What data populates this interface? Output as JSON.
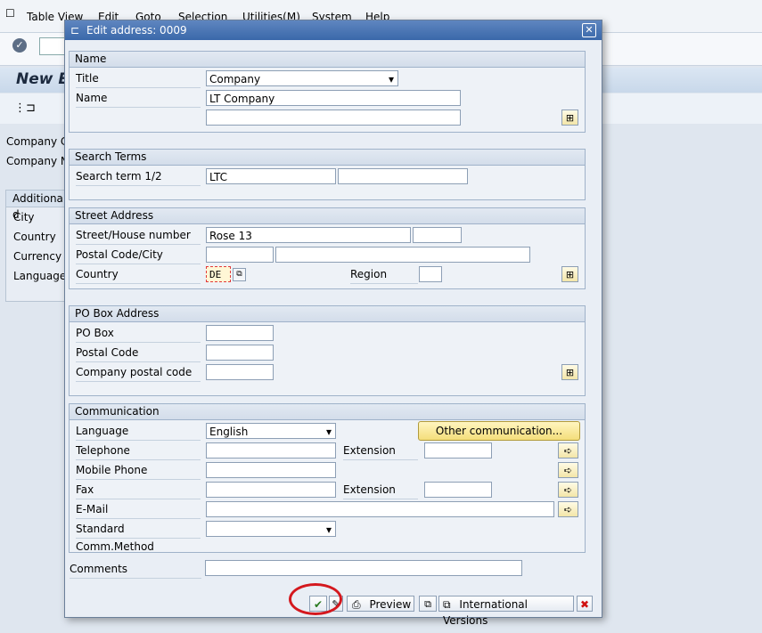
{
  "menu": {
    "items": [
      "Table View",
      "Edit",
      "Goto",
      "Selection",
      "Utilities(M)",
      "System",
      "Help"
    ]
  },
  "app": {
    "title": "New E",
    "fields": [
      "Company Co",
      "Company Na"
    ],
    "additional_header": "Additional d",
    "additional_rows": [
      "City",
      "Country",
      "Currency",
      "Language"
    ]
  },
  "dialog": {
    "title": "Edit address:  0009",
    "close_label": "✕",
    "name_group": {
      "header": "Name",
      "title_label": "Title",
      "title_value": "Company",
      "name_label": "Name",
      "name_value": "LT Company",
      "name2_value": ""
    },
    "search_group": {
      "header": "Search Terms",
      "label": "Search term 1/2",
      "term1": "LTC",
      "term2": ""
    },
    "street_group": {
      "header": "Street Address",
      "street_label": "Street/House number",
      "street_value": "Rose 13",
      "house_value": "",
      "postal_label": "Postal Code/City",
      "postal_value": "",
      "city_value": "",
      "country_label": "Country",
      "country_value": "DE",
      "region_label": "Region",
      "region_value": ""
    },
    "pobox_group": {
      "header": "PO Box Address",
      "pobox_label": "PO Box",
      "postal_label": "Postal Code",
      "company_postal_label": "Company postal code"
    },
    "comm_group": {
      "header": "Communication",
      "language_label": "Language",
      "language_value": "English",
      "other_button": "Other communication...",
      "telephone_label": "Telephone",
      "extension_label": "Extension",
      "mobile_label": "Mobile Phone",
      "fax_label": "Fax",
      "fax_extension_label": "Extension",
      "email_label": "E-Mail",
      "std_method_label": "Standard Comm.Method",
      "std_method_value": ""
    },
    "comments_label": "Comments",
    "comments_value": "",
    "buttons": {
      "preview": "Preview",
      "international": "International Versions"
    }
  },
  "colors": {
    "title_bar": "#3a68aa",
    "highlight_circle": "#d4181e",
    "required_border": "#e23a3a"
  }
}
